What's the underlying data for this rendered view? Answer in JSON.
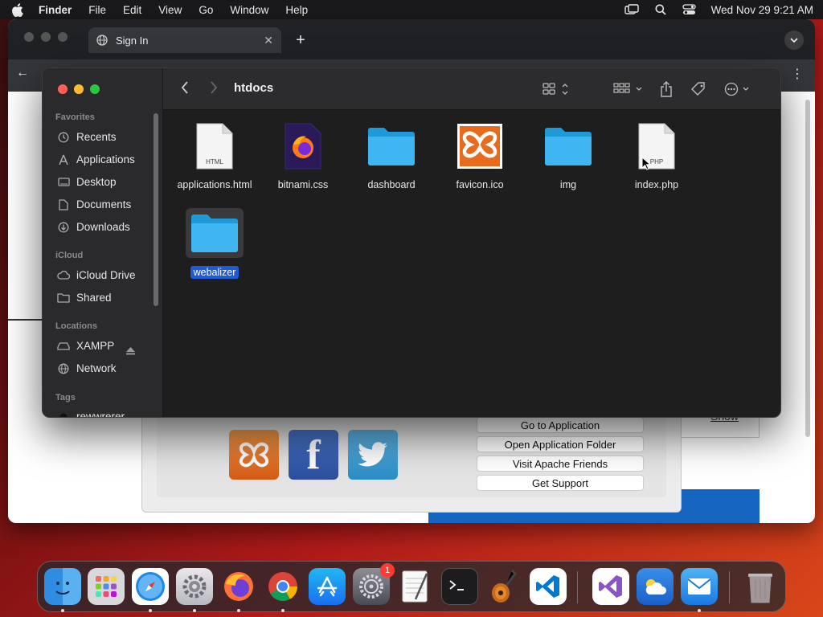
{
  "menubar": {
    "app_name": "Finder",
    "items": [
      "File",
      "Edit",
      "View",
      "Go",
      "Window",
      "Help"
    ],
    "datetime": "Wed Nov 29  9:21 AM"
  },
  "browser": {
    "tab_title": "Sign In",
    "xampp_buttons": [
      "Go to Application",
      "Open Application Folder",
      "Visit Apache Friends",
      "Get Support"
    ],
    "show_link": "Show"
  },
  "finder": {
    "folder_title": "htdocs",
    "sidebar": {
      "favorites_header": "Favorites",
      "favorites": [
        "Recents",
        "Applications",
        "Desktop",
        "Documents",
        "Downloads"
      ],
      "icloud_header": "iCloud",
      "icloud": [
        "iCloud Drive",
        "Shared"
      ],
      "locations_header": "Locations",
      "locations": [
        "XAMPP",
        "Network"
      ],
      "tags_header": "Tags",
      "tags": [
        "rewwrerer"
      ]
    },
    "files": [
      {
        "name": "applications.html",
        "kind": "html-doc",
        "badge": "HTML"
      },
      {
        "name": "bitnami.css",
        "kind": "firefox-doc"
      },
      {
        "name": "dashboard",
        "kind": "folder"
      },
      {
        "name": "favicon.ico",
        "kind": "xampp-icon"
      },
      {
        "name": "img",
        "kind": "folder"
      },
      {
        "name": "index.php",
        "kind": "php-doc",
        "badge": "PHP"
      },
      {
        "name": "webalizer",
        "kind": "folder",
        "selected": true
      }
    ]
  },
  "dock": {
    "apps": [
      "Finder",
      "Launchpad",
      "Safari",
      "System Settings",
      "Firefox",
      "Chrome",
      "App Store",
      "System Preferences",
      "TextEdit",
      "Terminal",
      "GarageBand",
      "Visual Studio Code",
      "Visual Studio",
      "Weather",
      "Mail",
      "Trash"
    ],
    "notification_badge": "1"
  },
  "colors": {
    "accent_selection": "#1f5bd6",
    "folder_blue": "#3fb6f2",
    "finder_bg": "#1e1e1e",
    "sidebar_bg": "#2a2a2c"
  }
}
